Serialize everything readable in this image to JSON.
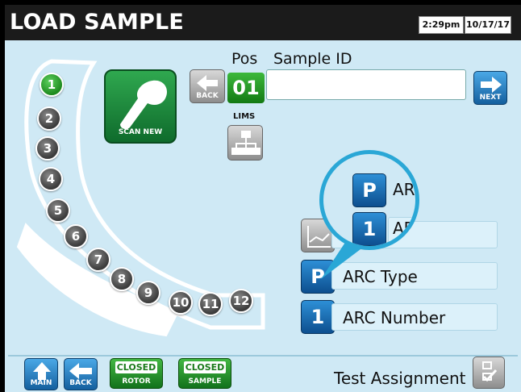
{
  "header": {
    "title": "LOAD SAMPLE",
    "time": "2:29pm",
    "date": "10/17/17"
  },
  "positions": [
    "1",
    "2",
    "3",
    "4",
    "5",
    "6",
    "7",
    "8",
    "9",
    "10",
    "11",
    "12"
  ],
  "active_position": "1",
  "scan_button": {
    "label": "SCAN NEW"
  },
  "back_top": {
    "label": "BACK"
  },
  "next_button": {
    "label": "NEXT"
  },
  "sample_entry": {
    "pos_label": "Pos",
    "sample_id_label": "Sample ID",
    "position_value": "01",
    "sample_id_value": ""
  },
  "lims": {
    "label": "LIMS"
  },
  "fields": {
    "zoom_p": "P",
    "zoom_ar": "AR",
    "zoom_1": "1",
    "zoom_arol": "AR ol",
    "arc_type_tile": "P",
    "arc_type_label": "ARC Type",
    "arc_number_tile": "1",
    "arc_number_label": "ARC Number"
  },
  "bottom": {
    "main_label": "MAIN",
    "back_label": "BACK",
    "closed_rotor_top": "CLOSED",
    "closed_rotor_bottom": "ROTOR",
    "closed_sample_top": "CLOSED",
    "closed_sample_bottom": "SAMPLE",
    "test_assignment": "Test Assignment"
  },
  "colors": {
    "accent_green": "#137a13",
    "accent_blue": "#0d4f8f",
    "zoom_ring": "#2aa7d6",
    "background": "#cfe9f5"
  }
}
